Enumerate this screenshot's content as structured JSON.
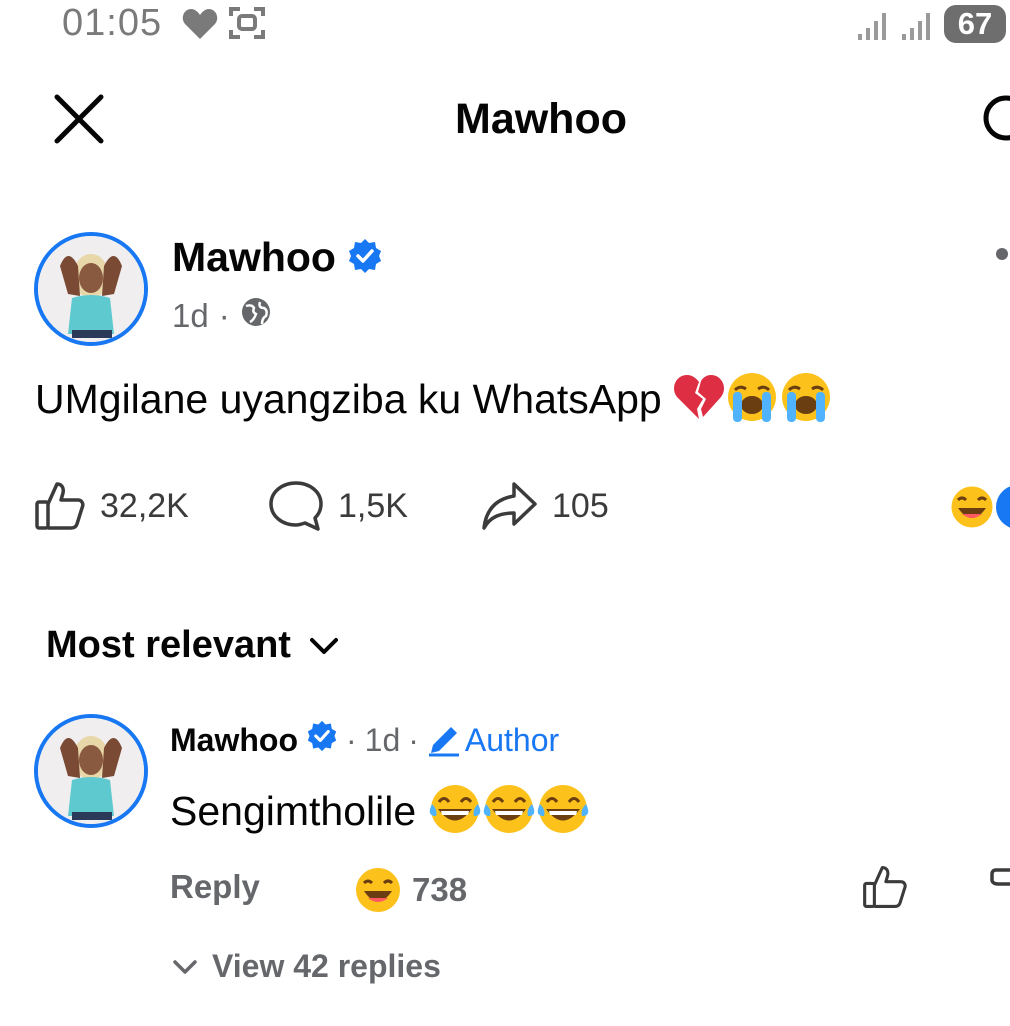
{
  "status_bar": {
    "time": "01:05",
    "battery": "67"
  },
  "header": {
    "title": "Mawhoo"
  },
  "post": {
    "author": "Mawhoo",
    "age": "1d",
    "separator": "·",
    "text": "UMgilane uyangziba ku WhatsApp",
    "likes": "32,2K",
    "comments": "1,5K",
    "shares": "105"
  },
  "sort": {
    "label": "Most relevant"
  },
  "comment": {
    "author": "Mawhoo",
    "age": "1d",
    "separator": "·",
    "badge": "Author",
    "text": "Sengimtholile",
    "reply_label": "Reply",
    "reaction_count": "738",
    "view_replies": "View 42 replies"
  },
  "colors": {
    "accent": "#1877f2",
    "muted_text": "#65676b",
    "text": "#050505"
  }
}
